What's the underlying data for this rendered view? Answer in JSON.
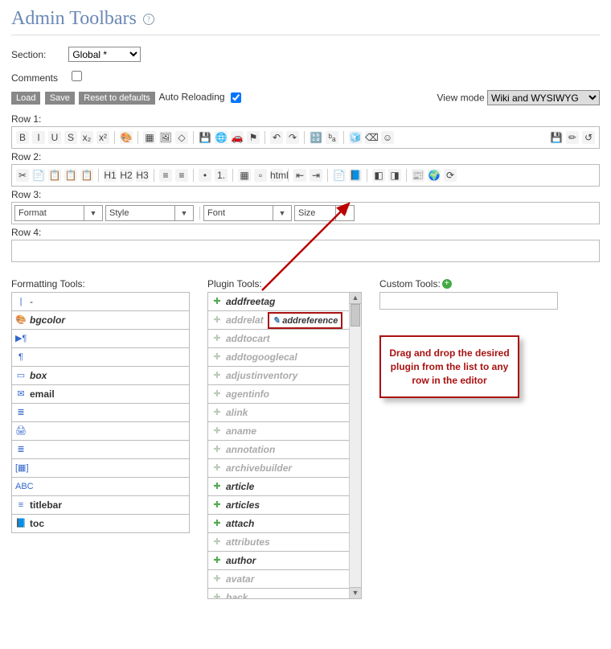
{
  "title": "Admin Toolbars",
  "section_label": "Section:",
  "section_value": "Global *",
  "comments_label": "Comments",
  "comments_checked": false,
  "buttons": {
    "load": "Load",
    "save": "Save",
    "reset": "Reset to defaults"
  },
  "autoreload_label": " Auto Reloading",
  "autoreload_checked": true,
  "viewmode_label": "View mode",
  "viewmode_value": "Wiki and WYSIWYG",
  "rows": {
    "r1": "Row 1:",
    "r2": "Row 2:",
    "r3": "Row 3:",
    "r4": "Row 4:"
  },
  "row1_icons": [
    "B",
    "I",
    "U",
    "S",
    "x₂",
    "x²",
    "|",
    "🎨",
    "|",
    "▦",
    "🖼",
    "◇",
    "|",
    "💾",
    "🌐",
    "🚗",
    "⚑",
    "|",
    "↶",
    "↷",
    "|",
    "🔡",
    "ᵇₐ",
    "|",
    "🧊",
    "⌫",
    "☺"
  ],
  "row1_right": [
    "💾",
    "✏",
    "↺"
  ],
  "row2_icons": [
    "✂",
    "📄",
    "📋",
    "📋",
    "📋",
    "|",
    "H1",
    "H2",
    "H3",
    "|",
    "≡",
    "≡",
    "|",
    "•",
    "1.",
    "|",
    "▦",
    "▫",
    "html",
    "|",
    "⇤",
    "⇥",
    "|",
    "📄",
    "📘",
    "|",
    "◧",
    "◨",
    "|",
    "📰",
    "🌍",
    "⟳"
  ],
  "combos": {
    "format": "Format",
    "style": "Style",
    "font": "Font",
    "size": "Size"
  },
  "ft_title": "Formatting Tools:",
  "ft_items": [
    {
      "txt": "-",
      "bold": false,
      "ital": false,
      "ic": "|"
    },
    {
      "txt": "bgcolor",
      "bold": true,
      "ital": true,
      "ic": "🎨"
    },
    {
      "txt": "",
      "bold": false,
      "ital": false,
      "ic": "▶¶"
    },
    {
      "txt": "",
      "bold": false,
      "ital": false,
      "ic": "¶"
    },
    {
      "txt": "box",
      "bold": true,
      "ital": true,
      "ic": "▭"
    },
    {
      "txt": "email",
      "bold": true,
      "ital": false,
      "ic": "✉"
    },
    {
      "txt": "",
      "bold": false,
      "ital": false,
      "ic": "≣"
    },
    {
      "txt": "",
      "bold": false,
      "ital": false,
      "ic": "🖨"
    },
    {
      "txt": "",
      "bold": false,
      "ital": false,
      "ic": "≣"
    },
    {
      "txt": "",
      "bold": false,
      "ital": false,
      "ic": "[▦]"
    },
    {
      "txt": "",
      "bold": false,
      "ital": false,
      "ic": "ABC"
    },
    {
      "txt": "titlebar",
      "bold": true,
      "ital": false,
      "ic": "≡"
    },
    {
      "txt": "toc",
      "bold": true,
      "ital": false,
      "ic": "📘"
    }
  ],
  "pt_title": "Plugin Tools:",
  "pt_items": [
    {
      "txt": "addfreetag",
      "dis": false
    },
    {
      "txt": "addrelat",
      "dis": true
    },
    {
      "txt": "addtocart",
      "dis": true
    },
    {
      "txt": "addtogooglecal",
      "dis": true
    },
    {
      "txt": "adjustinventory",
      "dis": true
    },
    {
      "txt": "agentinfo",
      "dis": true
    },
    {
      "txt": "alink",
      "dis": true
    },
    {
      "txt": "aname",
      "dis": true
    },
    {
      "txt": "annotation",
      "dis": true
    },
    {
      "txt": "archivebuilder",
      "dis": true
    },
    {
      "txt": "article",
      "dis": false
    },
    {
      "txt": "articles",
      "dis": false
    },
    {
      "txt": "attach",
      "dis": false
    },
    {
      "txt": "attributes",
      "dis": true
    },
    {
      "txt": "author",
      "dis": false
    },
    {
      "txt": "avatar",
      "dis": true
    },
    {
      "txt": "back",
      "dis": true
    }
  ],
  "drag_label": "addreference",
  "ct_title": "Custom Tools:",
  "callout": "Drag and drop the desired plugin from the list to any row in the editor"
}
